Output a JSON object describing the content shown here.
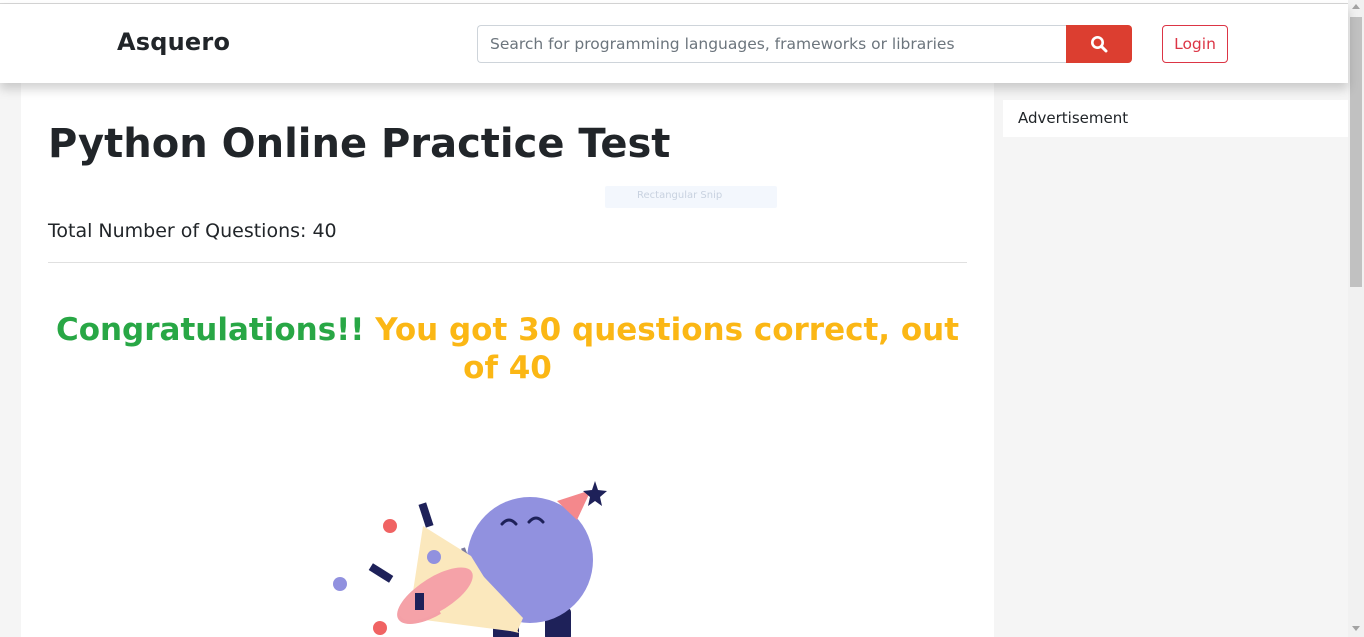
{
  "header": {
    "brand": "Asquero",
    "search_placeholder": "Search for programming languages, frameworks or libraries",
    "search_icon": "search-icon",
    "login_label": "Login",
    "accent_color": "#dc3e30"
  },
  "main": {
    "title": "Python Online Practice Test",
    "total_questions_text": "Total Number of Questions: 40",
    "result": {
      "congrats_text": "Congratulations!!",
      "score_text": "You got 30 questions correct, out of 40",
      "congrats_color": "#28a745",
      "score_color": "#fbb715"
    },
    "illustration_icon": "party-megaphone-celebration-icon",
    "overlay_hint": "Rectangular Snip"
  },
  "sidebar": {
    "ad_label": "Advertisement"
  }
}
